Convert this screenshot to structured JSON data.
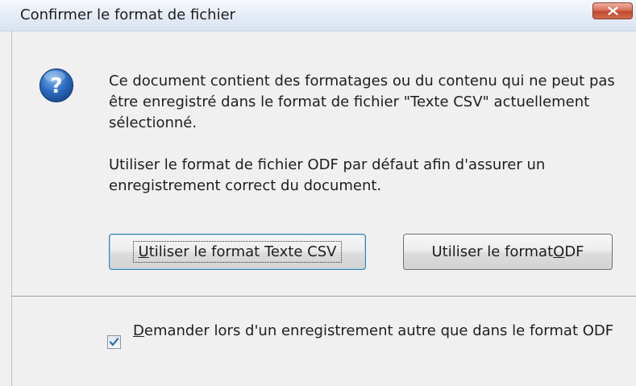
{
  "window": {
    "title": "Confirmer le format de fichier"
  },
  "icons": {
    "info": "question-mark-icon",
    "close": "close-icon",
    "check": "checkmark-icon"
  },
  "message": {
    "line1": "Ce document contient des formatages ou du contenu qui ne peut pas être enregistré dans le format de fichier \"Texte CSV\" actuellement sélectionné.",
    "line2": "Utiliser le format de fichier ODF par défaut afin d'assurer un enregistrement correct du document."
  },
  "buttons": {
    "csv": {
      "mnemonic": "U",
      "rest": "tiliser le format Texte CSV"
    },
    "odf": {
      "prefix": "Utiliser le format ",
      "mnemonic": "O",
      "suffix": "DF"
    }
  },
  "checkbox": {
    "checked": true,
    "mnemonic": "D",
    "rest": "emander lors d'un enregistrement autre que dans le format ODF"
  },
  "colors": {
    "accent_blue": "#2a6bb8",
    "close_red": "#c24a30"
  }
}
